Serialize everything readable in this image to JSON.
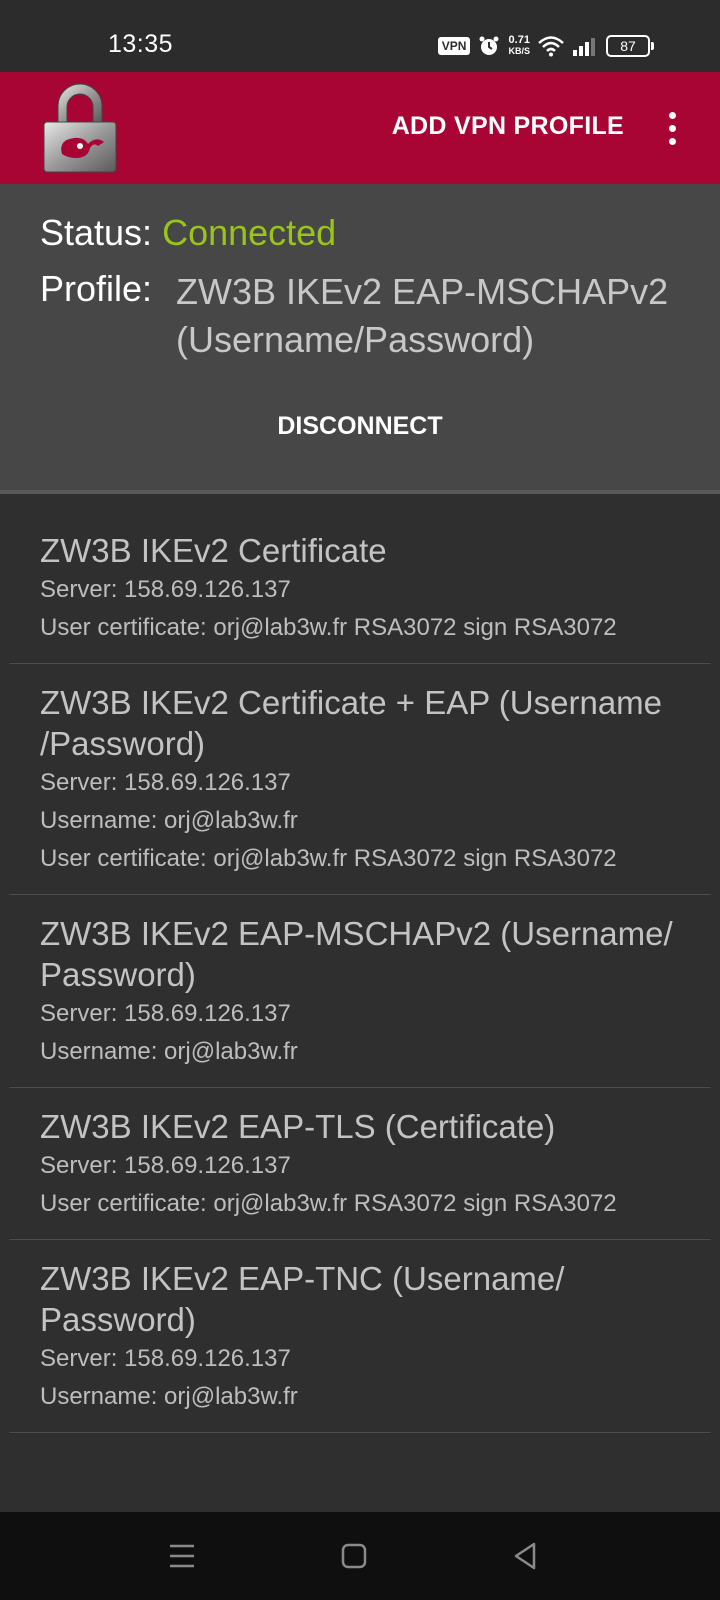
{
  "statusbar": {
    "time": "13:35",
    "vpn_badge": "VPN",
    "speed_value": "0.71",
    "speed_unit": "KB/S",
    "battery": "87"
  },
  "appbar": {
    "add_profile_label": "ADD VPN PROFILE",
    "accent_color": "#a80535"
  },
  "status": {
    "status_label": "Status:",
    "status_value": "Connected",
    "status_color": "#9ac31c",
    "profile_label": "Profile:",
    "profile_line1": "ZW3B IKEv2 EAP-MSCHAPv2",
    "profile_line2": "(Username/Password)",
    "disconnect_label": "DISCONNECT"
  },
  "profiles": [
    {
      "name": "ZW3B IKEv2 Certificate",
      "server": "Server: 158.69.126.137",
      "cert": "User certificate: orj@lab3w.fr RSA3072 sign RSA3072"
    },
    {
      "name": "ZW3B IKEv2 Certificate + EAP (Username /Password)",
      "server": "Server: 158.69.126.137",
      "username": "Username: orj@lab3w.fr",
      "cert": "User certificate: orj@lab3w.fr RSA3072 sign RSA3072"
    },
    {
      "name": "ZW3B IKEv2 EAP-MSCHAPv2 (Username/ Password)",
      "server": "Server: 158.69.126.137",
      "username": "Username: orj@lab3w.fr"
    },
    {
      "name": "ZW3B IKEv2 EAP-TLS (Certificate)",
      "server": "Server: 158.69.126.137",
      "cert": "User certificate: orj@lab3w.fr RSA3072 sign RSA3072"
    },
    {
      "name": "ZW3B IKEv2 EAP-TNC (Username/ Password)",
      "server": "Server: 158.69.126.137",
      "username": "Username: orj@lab3w.fr"
    }
  ]
}
